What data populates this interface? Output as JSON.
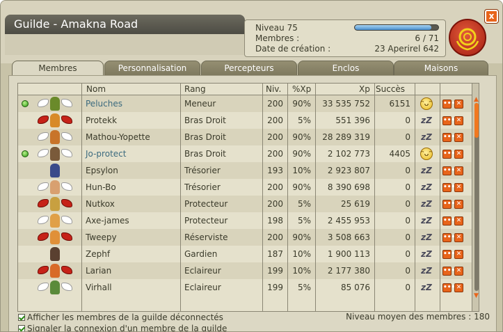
{
  "window": {
    "title": "Guilde - Amakna Road",
    "close_label": "x"
  },
  "info": {
    "niveau_label": "Niveau 75",
    "membres_label": "Membres :",
    "membres_value": "6 / 71",
    "creation_label": "Date de création :",
    "creation_value": "23 Aperirel 642",
    "xp_progress": 0.92
  },
  "tabs": [
    {
      "label": "Membres",
      "active": true
    },
    {
      "label": "Personnalisation",
      "active": false
    },
    {
      "label": "Percepteurs",
      "active": false
    },
    {
      "label": "Enclos",
      "active": false
    },
    {
      "label": "Maisons",
      "active": false
    }
  ],
  "columns": {
    "nom": "Nom",
    "rang": "Rang",
    "niv": "Niv.",
    "pxp": "%Xp",
    "xp": "Xp",
    "succes": "Succès"
  },
  "members": [
    {
      "online": true,
      "name": "Peluches",
      "rank": "Meneur",
      "level": "200",
      "pxp": "90%",
      "xp": "33 535 752",
      "succes": "6151",
      "state": "available",
      "wings": "white",
      "body": "#6a8a2a"
    },
    {
      "online": false,
      "name": "Protekk",
      "rank": "Bras Droit",
      "level": "200",
      "pxp": "5%",
      "xp": "551 396",
      "succes": "0",
      "state": "away",
      "wings": "red",
      "body": "#d88a28"
    },
    {
      "online": false,
      "name": "Mathou-Yopette",
      "rank": "Bras Droit",
      "level": "200",
      "pxp": "90%",
      "xp": "28 289 319",
      "succes": "0",
      "state": "away",
      "wings": "white",
      "body": "#c8742a"
    },
    {
      "online": true,
      "name": "Jo-protect",
      "rank": "Bras Droit",
      "level": "200",
      "pxp": "90%",
      "xp": "2 102 773",
      "succes": "4405",
      "state": "available",
      "wings": "white",
      "body": "#7a5a3a"
    },
    {
      "online": false,
      "name": "Epsylon",
      "rank": "Trésorier",
      "level": "193",
      "pxp": "10%",
      "xp": "2 923 807",
      "succes": "0",
      "state": "away",
      "wings": "none",
      "body": "#3a4a8a"
    },
    {
      "online": false,
      "name": "Hun-Bo",
      "rank": "Trésorier",
      "level": "200",
      "pxp": "90%",
      "xp": "8 390 698",
      "succes": "0",
      "state": "away",
      "wings": "white",
      "body": "#d8a070"
    },
    {
      "online": false,
      "name": "Nutkox",
      "rank": "Protecteur",
      "level": "200",
      "pxp": "5%",
      "xp": "25 619",
      "succes": "0",
      "state": "away",
      "wings": "red",
      "body": "#c8a040"
    },
    {
      "online": false,
      "name": "Axe-james",
      "rank": "Protecteur",
      "level": "198",
      "pxp": "5%",
      "xp": "2 455 953",
      "succes": "0",
      "state": "away",
      "wings": "white",
      "body": "#e0a048"
    },
    {
      "online": false,
      "name": "Tweepy",
      "rank": "Réserviste",
      "level": "200",
      "pxp": "90%",
      "xp": "3 508 663",
      "succes": "0",
      "state": "away",
      "wings": "red",
      "body": "#e09038"
    },
    {
      "online": false,
      "name": "Zephf",
      "rank": "Gardien",
      "level": "187",
      "pxp": "10%",
      "xp": "1 900 113",
      "succes": "0",
      "state": "away",
      "wings": "none",
      "body": "#5a4030"
    },
    {
      "online": false,
      "name": "Larian",
      "rank": "Eclaireur",
      "level": "199",
      "pxp": "10%",
      "xp": "2 177 380",
      "succes": "0",
      "state": "away",
      "wings": "red",
      "body": "#d86a28"
    },
    {
      "online": false,
      "name": "Virhall",
      "rank": "Eclaireur",
      "level": "199",
      "pxp": "5%",
      "xp": "85 076",
      "succes": "0",
      "state": "away",
      "wings": "white",
      "body": "#5a8a3a"
    }
  ],
  "icons": {
    "available": "smiley-icon",
    "away": "zzz-icon",
    "menu": "more-icon",
    "kick": "close-icon"
  },
  "options": {
    "show_offline": "Afficher les membres de la guilde déconnectés",
    "notify_login": "Signaler la connexion d'un membre de la guilde",
    "average_level": "Niveau moyen des membres : 180"
  },
  "colors": {
    "accent": "#e8641a",
    "online_name": "#3b6a7e",
    "xp_bar": "#4a8fcf"
  }
}
